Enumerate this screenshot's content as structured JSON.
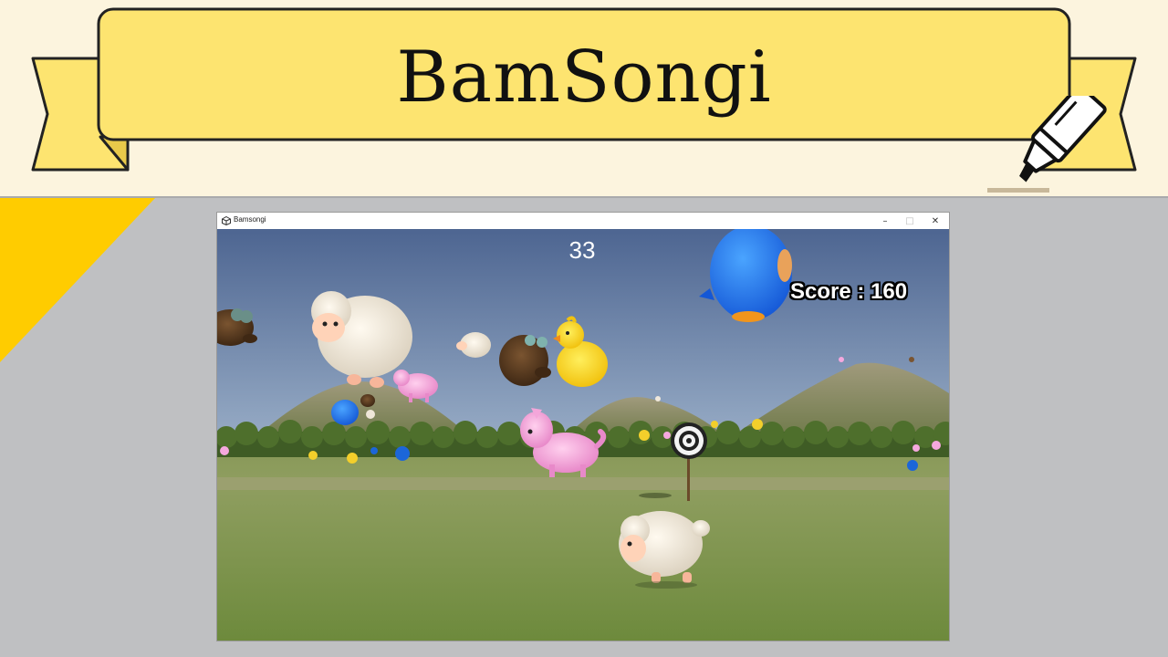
{
  "banner": {
    "title": "BamSongi",
    "colors": {
      "band": "#fcf4de",
      "ribbon": "#fde470",
      "ribbon_shadow": "#fbd84a",
      "corner": "#ffcc00"
    }
  },
  "window": {
    "title": "Bamsongi",
    "minimize_label": "–",
    "maximize_label": "□",
    "close_label": "✕"
  },
  "hud": {
    "timer": "33",
    "score": "Score : 160"
  },
  "scene_objects": [
    "sheep-large",
    "sheep-small",
    "sheep-player",
    "bear-brown",
    "bear-left-edge",
    "chick-yellow",
    "penguin-blue-large",
    "penguin-blue-small",
    "pony-pink-large",
    "pony-pink-small",
    "target-board",
    "mountains",
    "tree-line",
    "grass-field"
  ]
}
